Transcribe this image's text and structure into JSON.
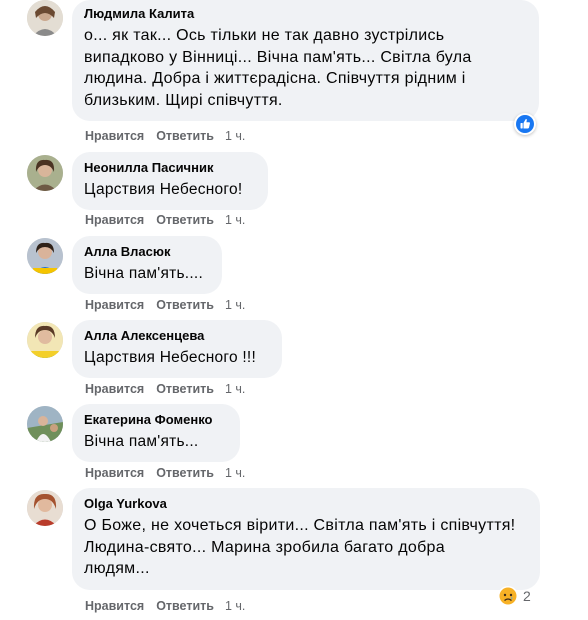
{
  "comments": [
    {
      "author": "Людмила Калита",
      "lines": [
        "о... як так... Ось тільки не так давно зустрілись",
        "випадково у Вінниці... Вічна пам'ять... Світла була",
        "людина. Добра і життєрадісна. Співчуття рідним і",
        "близьким. Щирі співчуття."
      ],
      "like_label": "Нравится",
      "reply_label": "Ответить",
      "time": "1 ч."
    },
    {
      "author": "Неонилла Пасичник",
      "lines": [
        "Царствия Небесного!"
      ],
      "like_label": "Нравится",
      "reply_label": "Ответить",
      "time": "1 ч."
    },
    {
      "author": "Алла Власюк",
      "lines": [
        "Вічна пам'ять...."
      ],
      "like_label": "Нравится",
      "reply_label": "Ответить",
      "time": "1 ч."
    },
    {
      "author": "Алла Алексенцева",
      "lines": [
        "Царствия Небесного !!!"
      ],
      "like_label": "Нравится",
      "reply_label": "Ответить",
      "time": "1 ч."
    },
    {
      "author": "Екатерина Фоменко",
      "lines": [
        "Вічна пам'ять..."
      ],
      "like_label": "Нравится",
      "reply_label": "Ответить",
      "time": "1 ч."
    },
    {
      "author": "Olga Yurkova",
      "lines": [
        "О Боже, не хочеться вірити... Світла пам'ять і співчуття!",
        "Людина-свято... Марина зробила багато добра",
        "людям..."
      ],
      "like_label": "Нравится",
      "reply_label": "Ответить",
      "time": "1 ч.",
      "reaction_count": "2"
    }
  ],
  "icons": {
    "like_reaction": "thumbs-up-icon",
    "sad_reaction": "sad-face-icon"
  },
  "colors": {
    "bubble": "#f0f2f5",
    "meta_text": "#65676b",
    "like_blue": "#1877f2",
    "sad_yellow": "#f7b125"
  }
}
